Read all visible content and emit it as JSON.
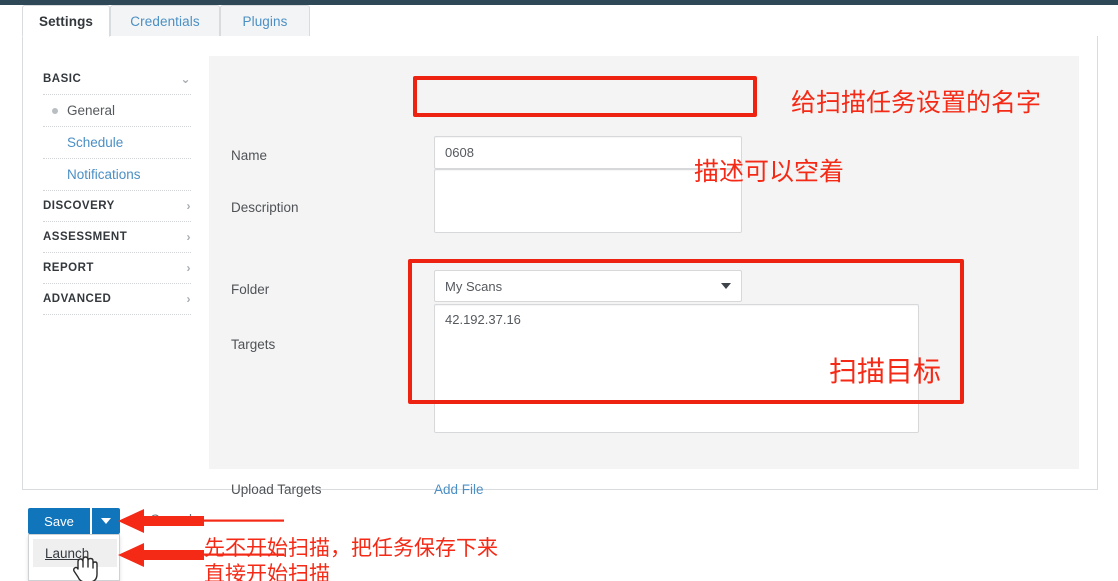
{
  "tabs": [
    {
      "label": "Settings",
      "active": true
    },
    {
      "label": "Credentials",
      "active": false
    },
    {
      "label": "Plugins",
      "active": false
    }
  ],
  "sidebar": {
    "groups": [
      {
        "label": "BASIC",
        "icon": "chevron-down-icon",
        "expanded": true
      },
      {
        "label": "DISCOVERY",
        "icon": "chevron-right-icon",
        "expanded": false
      },
      {
        "label": "ASSESSMENT",
        "icon": "chevron-right-icon",
        "expanded": false
      },
      {
        "label": "REPORT",
        "icon": "chevron-right-icon",
        "expanded": false
      },
      {
        "label": "ADVANCED",
        "icon": "chevron-right-icon",
        "expanded": false
      }
    ],
    "basic_items": [
      {
        "label": "General",
        "current": true
      },
      {
        "label": "Schedule",
        "current": false
      },
      {
        "label": "Notifications",
        "current": false
      }
    ],
    "chevron_down": "⌄",
    "chevron_right": "›"
  },
  "form": {
    "name": {
      "label": "Name",
      "value": "0608",
      "placeholder": ""
    },
    "description": {
      "label": "Description",
      "value": "",
      "placeholder": ""
    },
    "folder": {
      "label": "Folder",
      "value": "My Scans",
      "options": [
        "My Scans"
      ]
    },
    "targets": {
      "label": "Targets",
      "value": "42.192.37.16",
      "placeholder": ""
    },
    "upload_targets": {
      "label": "Upload Targets",
      "link_label": "Add File"
    }
  },
  "buttons": {
    "save": "Save",
    "cancel": "Cancel",
    "launch": "Launch",
    "dropdown_icon": "caret-down-icon"
  },
  "annotations": {
    "name": "给扫描任务设置的名字",
    "description": "描述可以空着",
    "targets": "扫描目标",
    "save": "先不开始扫描，把任务保存下来",
    "launch": "直接开始扫描"
  },
  "colors": {
    "accent_blue": "#1175bc",
    "link_blue": "#4b8fc4",
    "annotation_red": "#f42a16",
    "box_red": "#ee2211",
    "topbar": "#2f4858",
    "form_bg": "#f4f4f4"
  }
}
